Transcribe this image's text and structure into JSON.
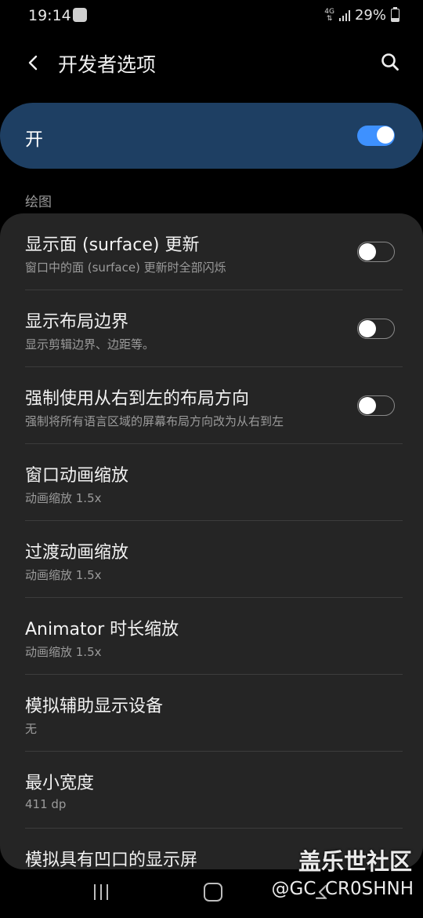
{
  "status_bar": {
    "time": "19:14",
    "network": "4G",
    "battery": "29%",
    "battery_level": 0.29
  },
  "header": {
    "title": "开发者选项",
    "back_icon": "chevron-left-icon",
    "search_icon": "search-icon"
  },
  "master_switch": {
    "label": "开",
    "on": true
  },
  "section": {
    "label": "绘图"
  },
  "settings": [
    {
      "title": "显示面 (surface) 更新",
      "subtitle": "窗口中的面 (surface) 更新时全部闪烁",
      "toggle": false
    },
    {
      "title": "显示布局边界",
      "subtitle": "显示剪辑边界、边距等。",
      "toggle": false
    },
    {
      "title": "强制使用从右到左的布局方向",
      "subtitle": "强制将所有语言区域的屏幕布局方向改为从右到左",
      "toggle": false
    },
    {
      "title": "窗口动画缩放",
      "subtitle": "动画缩放 1.5x"
    },
    {
      "title": "过渡动画缩放",
      "subtitle": "动画缩放 1.5x"
    },
    {
      "title": "Animator 时长缩放",
      "subtitle": "动画缩放 1.5x"
    },
    {
      "title": "模拟辅助显示设备",
      "subtitle": "无"
    },
    {
      "title": "最小宽度",
      "subtitle": "411 dp"
    },
    {
      "title": "模拟具有凹口的显示屏",
      "subtitle": ""
    }
  ],
  "watermark": {
    "title": "盖乐世社区",
    "handle": "@GC_CR0SHNH"
  },
  "colors": {
    "accent": "#3e91ff",
    "master_background": "#1e3f63",
    "card_background": "#252525"
  }
}
